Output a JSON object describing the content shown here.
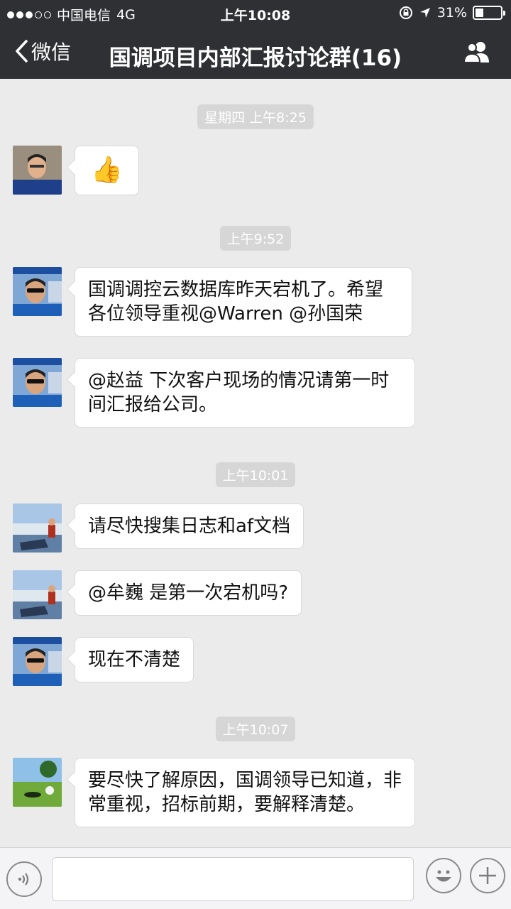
{
  "status_bar": {
    "carrier": "中国电信",
    "network": "4G",
    "time": "上午10:08",
    "battery": "31%",
    "battery_level": 0.31
  },
  "nav": {
    "back_label": "微信",
    "title": "国调项目内部汇报讨论群(16)",
    "right_icon": "group-members-icon"
  },
  "chat": {
    "timestamps": [
      "星期四 上午8:25",
      "上午9:52",
      "上午10:01",
      "上午10:07"
    ],
    "messages": [
      {
        "avatar": "man-glasses-portrait",
        "text": "👍"
      },
      {
        "avatar": "man-sunglasses-portrait",
        "text": "国调调控云数据库昨天宕机了。希望各位领导重视@Warren @孙国荣"
      },
      {
        "avatar": "man-sunglasses-portrait",
        "text": "@赵益 下次客户现场的情况请第一时间汇报给公司。"
      },
      {
        "avatar": "lake-scene-portrait",
        "text": "请尽快搜集日志和af文档"
      },
      {
        "avatar": "lake-scene-portrait",
        "text": "@牟巍 是第一次宕机吗?"
      },
      {
        "avatar": "man-sunglasses-portrait",
        "text": "现在不清楚"
      },
      {
        "avatar": "golf-scene-portrait",
        "text": "要尽快了解原因，国调领导已知道，非常重视，招标前期，要解释清楚。"
      }
    ]
  },
  "input_bar": {
    "value": "",
    "icons": [
      "voice-icon",
      "emoji-icon",
      "plus-icon"
    ]
  },
  "colors": {
    "topbar_bg": "#2e3034",
    "chat_bg": "#ebebeb",
    "bubble_bg": "#ffffff",
    "timestamp_bg": "#d6d6d6"
  }
}
